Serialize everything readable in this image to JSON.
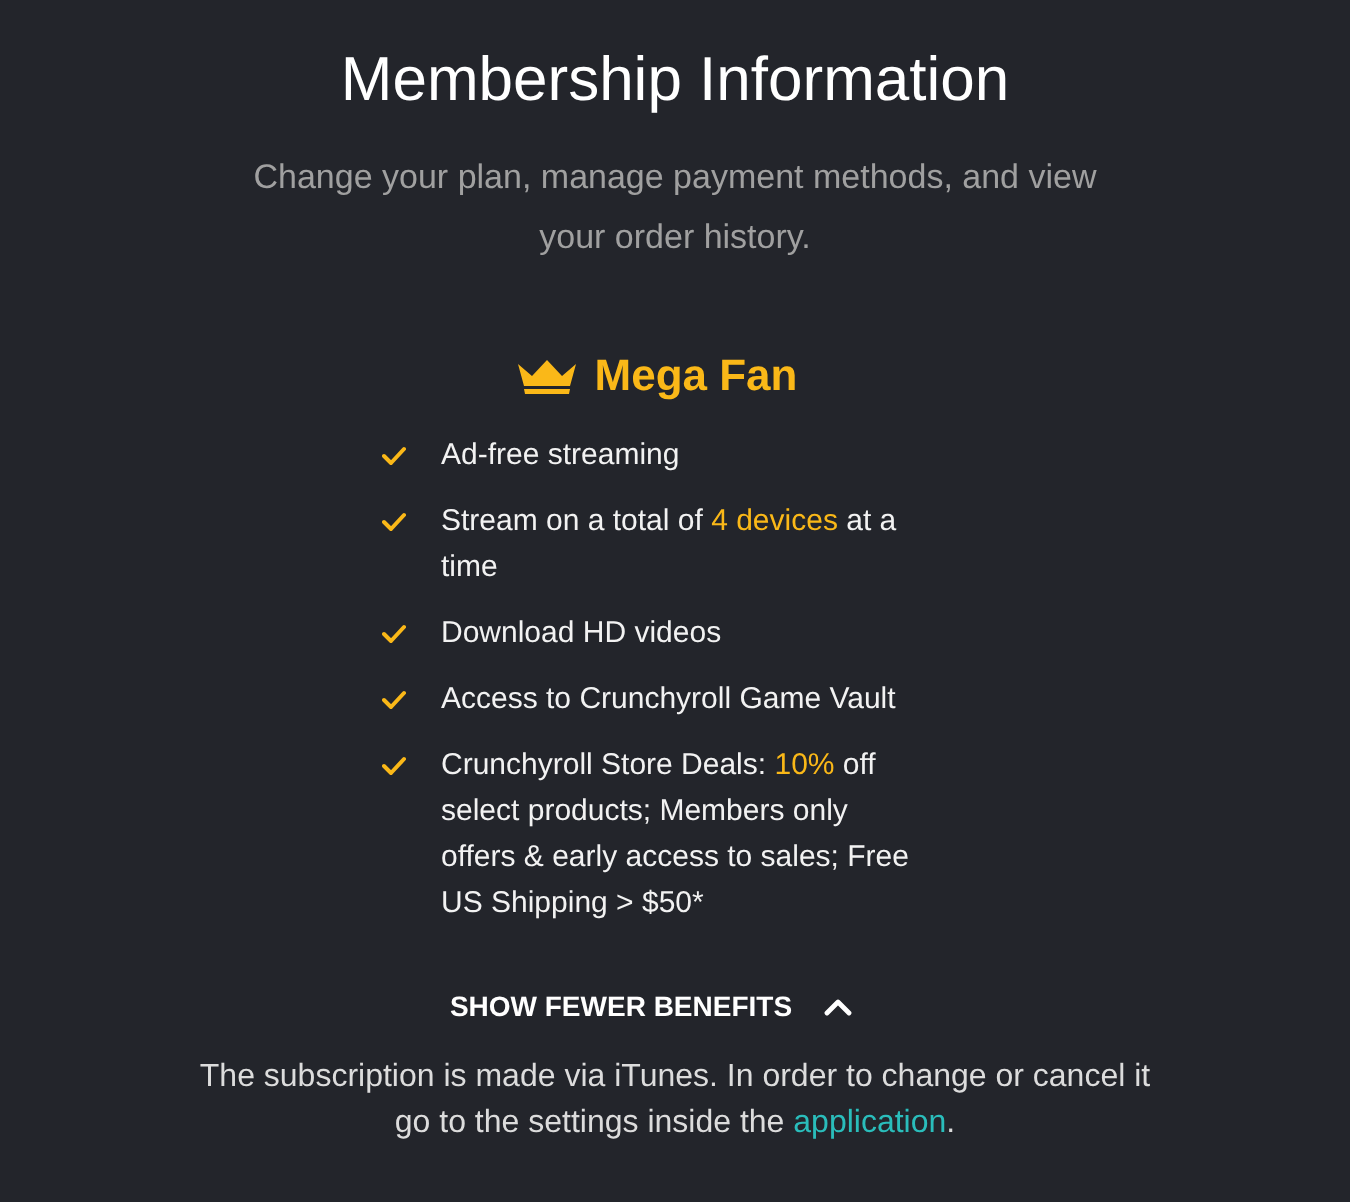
{
  "header": {
    "title": "Membership Information",
    "subtitle": "Change your plan, manage payment methods, and view your order history."
  },
  "plan": {
    "name": "Mega Fan",
    "benefits": [
      {
        "parts": [
          {
            "text": "Ad-free streaming",
            "highlight": false
          }
        ]
      },
      {
        "parts": [
          {
            "text": "Stream on a total of ",
            "highlight": false
          },
          {
            "text": "4 devices",
            "highlight": true
          },
          {
            "text": " at a time",
            "highlight": false
          }
        ]
      },
      {
        "parts": [
          {
            "text": "Download HD videos",
            "highlight": false
          }
        ]
      },
      {
        "parts": [
          {
            "text": "Access to Crunchyroll Game Vault",
            "highlight": false
          }
        ]
      },
      {
        "parts": [
          {
            "text": "Crunchyroll Store Deals: ",
            "highlight": false
          },
          {
            "text": "10%",
            "highlight": true
          },
          {
            "text": " off select products; Members only offers & early access to sales; Free US Shipping > $50*",
            "highlight": false
          }
        ]
      }
    ]
  },
  "toggle": {
    "label": "SHOW FEWER BENEFITS",
    "expanded": true
  },
  "note": {
    "text": "The subscription is made via iTunes. In order to change or cancel it go to the settings inside the ",
    "link": "application",
    "after": "."
  }
}
